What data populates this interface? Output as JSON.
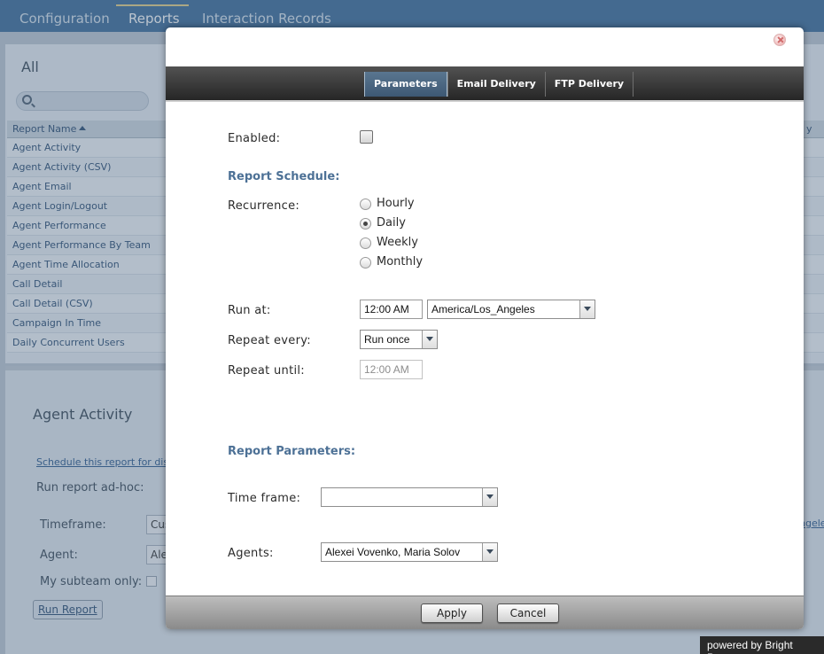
{
  "background": {
    "nav_tabs": [
      "Configuration",
      "Reports",
      "Interaction Records"
    ],
    "active_tab": "Reports",
    "list_title": "All",
    "column_header": "Report Name",
    "column_header_trailing": "y",
    "reports": [
      "Agent Activity",
      "Agent Activity (CSV)",
      "Agent Email",
      "Agent Login/Logout",
      "Agent Performance",
      "Agent Performance By Team",
      "Agent Time Allocation",
      "Call Detail",
      "Call Detail (CSV)",
      "Campaign In Time",
      "Daily Concurrent Users"
    ],
    "detail_title": "Agent Activity",
    "schedule_link": "Schedule this report for dis",
    "run_adhoc_label": "Run report ad-hoc:",
    "timeframe_label": "Timeframe:",
    "timeframe_value": "Cus",
    "agent_label": "Agent:",
    "agent_value": "Ale",
    "subteam_label": "My subteam only:",
    "run_report_button": "Run Report",
    "right_link_fragment": "ngele"
  },
  "modal": {
    "tabs": [
      "Parameters",
      "Email Delivery",
      "FTP Delivery"
    ],
    "active_tab": "Parameters",
    "enabled_label": "Enabled:",
    "enabled_checked": false,
    "schedule_heading": "Report Schedule:",
    "recurrence_label": "Recurrence:",
    "recurrence_options": [
      "Hourly",
      "Daily",
      "Weekly",
      "Monthly"
    ],
    "recurrence_selected": "Daily",
    "run_at_label": "Run at:",
    "run_at_time": "12:00 AM",
    "timezone": "America/Los_Angeles",
    "repeat_every_label": "Repeat every:",
    "repeat_every_value": "Run once",
    "repeat_until_label": "Repeat until:",
    "repeat_until_value": "12:00 AM",
    "parameters_heading": "Report Parameters:",
    "time_frame_label": "Time frame:",
    "time_frame_value": "",
    "agents_label": "Agents:",
    "agents_value": "Alexei Vovenko, Maria Solov",
    "apply_button": "Apply",
    "cancel_button": "Cancel"
  },
  "footer": {
    "brand": "powered by Bright Pattern"
  }
}
